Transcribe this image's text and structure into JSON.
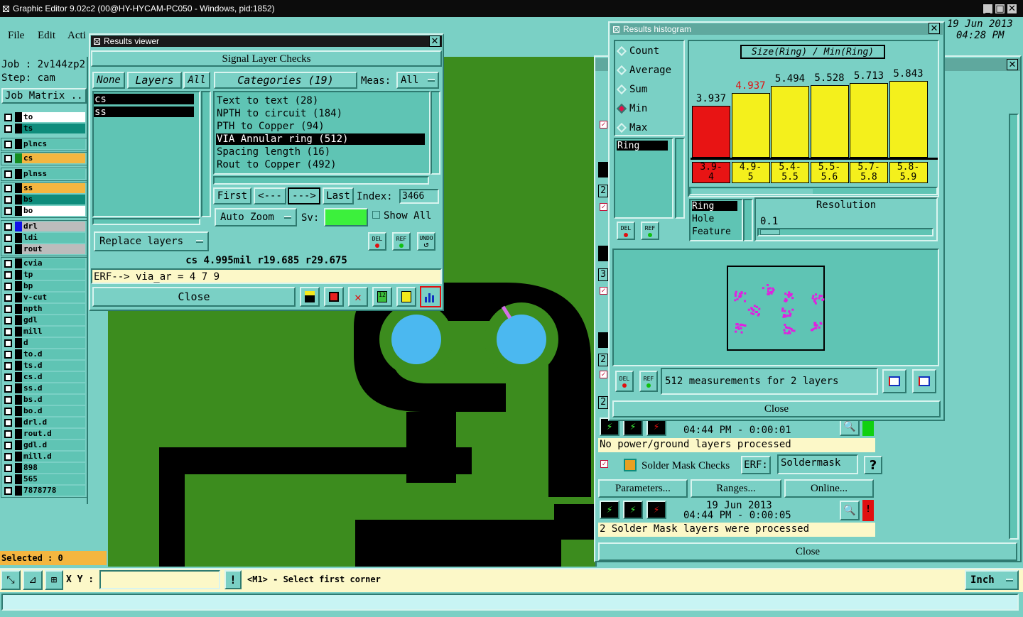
{
  "app": {
    "title": "Graphic Editor 9.02c2 (00@HY-HYCAM-PC050 - Windows, pid:1852)",
    "date": "19 Jun 2013",
    "time": "04:28 PM"
  },
  "menu": {
    "file": "File",
    "edit": "Edit",
    "actions": "Acti"
  },
  "left": {
    "job": "Job : 2v144zp2",
    "step": "Step: cam",
    "job_matrix": "Job Matrix ..",
    "layers": [
      {
        "name": "to",
        "color": "#ffffff"
      },
      {
        "name": "ts",
        "color": "#0e8c7c"
      },
      {
        "name": "plncs",
        "color": "#5fc4b4"
      },
      {
        "name": "cs",
        "color": "#f4b640"
      },
      {
        "name": "plnss",
        "color": "#5fc4b4"
      },
      {
        "name": "ss",
        "color": "#f4b640"
      },
      {
        "name": "bs",
        "color": "#0e8c7c"
      },
      {
        "name": "bo",
        "color": "#ffffff"
      },
      {
        "name": "drl",
        "color": "#bcbcbc"
      },
      {
        "name": "ldi",
        "color": "#5fc4b4"
      },
      {
        "name": "rout",
        "color": "#bcbcbc"
      },
      {
        "name": "cvia",
        "color": "#5fc4b4"
      },
      {
        "name": "tp",
        "color": "#5fc4b4"
      },
      {
        "name": "bp",
        "color": "#5fc4b4"
      },
      {
        "name": "v-cut",
        "color": "#5fc4b4"
      },
      {
        "name": "npth",
        "color": "#5fc4b4"
      },
      {
        "name": "gdl",
        "color": "#5fc4b4"
      },
      {
        "name": "mill",
        "color": "#5fc4b4"
      },
      {
        "name": "d",
        "color": "#5fc4b4"
      },
      {
        "name": "to.d",
        "color": "#5fc4b4"
      },
      {
        "name": "ts.d",
        "color": "#5fc4b4"
      },
      {
        "name": "cs.d",
        "color": "#5fc4b4"
      },
      {
        "name": "ss.d",
        "color": "#5fc4b4"
      },
      {
        "name": "bs.d",
        "color": "#5fc4b4"
      },
      {
        "name": "bo.d",
        "color": "#5fc4b4"
      },
      {
        "name": "drl.d",
        "color": "#5fc4b4"
      },
      {
        "name": "rout.d",
        "color": "#5fc4b4"
      },
      {
        "name": "gdl.d",
        "color": "#5fc4b4"
      },
      {
        "name": "mill.d",
        "color": "#5fc4b4"
      },
      {
        "name": "898",
        "color": "#5fc4b4"
      },
      {
        "name": "565",
        "color": "#5fc4b4"
      },
      {
        "name": "7878778",
        "color": "#5fc4b4"
      }
    ],
    "selected": "Selected : 0"
  },
  "results_viewer": {
    "title": "Results viewer",
    "header": "Signal Layer Checks",
    "none_btn": "None",
    "layers_btn": "Layers",
    "all_btn": "All",
    "layer_items": [
      "cs",
      "ss"
    ],
    "categories_btn": "Categories (19)",
    "meas_label": "Meas:",
    "meas_value": "All",
    "categories": [
      "Text to text (28)",
      "NPTH to circuit (184)",
      "PTH to Copper (94)",
      "VIA Annular ring (512)",
      "Spacing length (16)",
      "Rout to Copper (492)"
    ],
    "first": "First",
    "prev": "<---",
    "next": "--->",
    "last": "Last",
    "index_label": "Index:",
    "index_value": "3466",
    "auto_zoom": "Auto Zoom",
    "sv_label": "Sv:",
    "show_all": "Show All",
    "replace_layers": "Replace layers",
    "del": "DEL",
    "ref": "REF",
    "undo": "UNDO",
    "status": "cs 4.995mil r19.685 r29.675",
    "erf": "ERF--> via_ar = 4 7 9",
    "close": "Close"
  },
  "histogram": {
    "title": "Results histogram",
    "modes": [
      "Count",
      "Average",
      "Sum",
      "Min",
      "Max"
    ],
    "selected_mode": "Min",
    "chart_title": "Size(Ring) / Min(Ring)",
    "list_item": "Ring",
    "fields": [
      "Ring",
      "Hole",
      "Feature"
    ],
    "resolution_label": "Resolution",
    "resolution_value": "0.1",
    "del": "DEL",
    "ref": "REF",
    "measurements": "512 measurements for 2 layers",
    "close": "Close"
  },
  "chart_data": {
    "type": "bar",
    "title": "Size(Ring) / Min(Ring)",
    "categories": [
      "3.9-4",
      "4.9-5",
      "5.4-5.5",
      "5.5-5.6",
      "5.7-5.8",
      "5.8-5.9"
    ],
    "values": [
      3.937,
      4.937,
      5.494,
      5.528,
      5.713,
      5.843
    ],
    "colors": [
      "#e81414",
      "#f4f01c",
      "#f4f01c",
      "#f4f01c",
      "#f4f01c",
      "#f4f01c"
    ],
    "ylim": [
      0,
      6.5
    ]
  },
  "checks": {
    "timestamp1": "04:44 PM - 0:00:01",
    "status1": "No power/ground layers processed",
    "solder_mask": "Solder Mask Checks",
    "erf_label": "ERF:",
    "erf_value": "Soldermask",
    "help": "?",
    "parameters": "Parameters...",
    "ranges": "Ranges...",
    "online": "Online...",
    "date2": "19 Jun 2013",
    "timestamp2": "04:44 PM - 0:00:05",
    "status2": "2 Solder Mask layers were processed",
    "close": "Close",
    "side_numbers": [
      "2",
      "3",
      "2",
      "2"
    ]
  },
  "bottom": {
    "xy_label": "X Y :",
    "xy_value": "",
    "prompt": "<M1> - Select first corner",
    "units": "Inch",
    "alert": "!"
  }
}
